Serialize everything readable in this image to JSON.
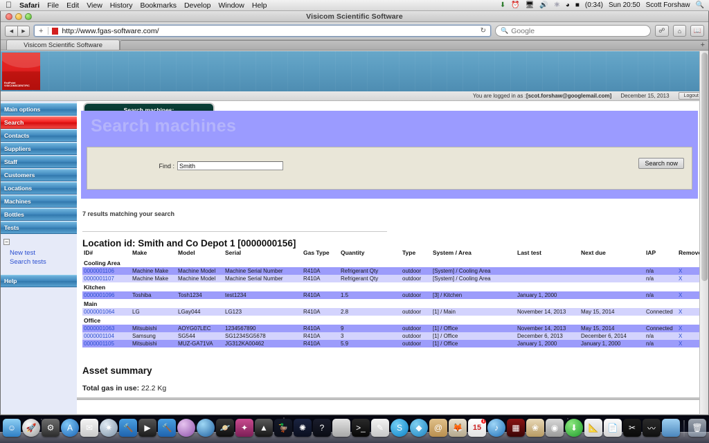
{
  "menubar": {
    "apple_glyph": "apple-logo",
    "items": [
      "Safari",
      "File",
      "Edit",
      "View",
      "History",
      "Bookmarks",
      "Develop",
      "Window",
      "Help"
    ],
    "status": {
      "battery_time": "(0:34)",
      "clock": "Sun 20:50",
      "user": "Scott Forshaw"
    }
  },
  "window": {
    "title": "Visicom Scientific Software",
    "url": "http://www.fgas-software.com/",
    "search_placeholder": "Google",
    "tab_label": "Visicom Scientific Software"
  },
  "loginbar": {
    "prefix": "You are logged in as :",
    "email": "[scot.forshaw@googlemail.com]",
    "date": "December 15, 2013",
    "logout": "Logout"
  },
  "logo": {
    "line1": "RedPoint",
    "line2": "VISICOMSCIENTIFIC"
  },
  "sidebar": {
    "items": [
      {
        "label": "Main options",
        "active": false
      },
      {
        "label": "Search",
        "active": true
      },
      {
        "label": "Contacts",
        "active": false
      },
      {
        "label": "Suppliers",
        "active": false
      },
      {
        "label": "Staff",
        "active": false
      },
      {
        "label": "Customers",
        "active": false
      },
      {
        "label": "Locations",
        "active": false
      },
      {
        "label": "Machines",
        "active": false
      },
      {
        "label": "Bottles",
        "active": false
      },
      {
        "label": "Tests",
        "active": false
      }
    ],
    "collapse_glyph": "−",
    "sublinks": [
      "New test",
      "Search tests"
    ],
    "help": "Help"
  },
  "panel": {
    "tab_label": "Search machines:",
    "heading": "Search machines",
    "find_label": "Find :",
    "find_value": "Smith",
    "search_button": "Search now"
  },
  "results": {
    "count_text": "7 results matching your search",
    "location_title": "Location id: Smith and Co Depot 1 [0000000156]"
  },
  "table": {
    "columns": [
      "ID#",
      "Make",
      "Model",
      "Serial",
      "Gas Type",
      "Quantity",
      "Type",
      "System / Area",
      "Last test",
      "Next due",
      "IAP",
      "Remove"
    ],
    "groups": [
      {
        "name": "Cooling Area",
        "rows": [
          {
            "id": "0000001106",
            "make": "Machine Make",
            "model": "Machine Model",
            "serial": "Machine Serial Number",
            "gas": "R410A",
            "qty": "Refrigerant Qty",
            "type": "outdoor",
            "system": "[System] / Cooling Area",
            "last": "",
            "next": "",
            "iap": "n/a",
            "remove": "X"
          },
          {
            "id": "0000001107",
            "make": "Machine Make",
            "model": "Machine Model",
            "serial": "Machine Serial Number",
            "gas": "R410A",
            "qty": "Refrigerant Qty",
            "type": "outdoor",
            "system": "[System] / Cooling Area",
            "last": "",
            "next": "",
            "iap": "n/a",
            "remove": "X"
          }
        ]
      },
      {
        "name": "Kitchen",
        "rows": [
          {
            "id": "0000001096",
            "make": "Toshiba",
            "model": "Tosh1234",
            "serial": "test1234",
            "gas": "R410A",
            "qty": "1.5",
            "type": "outdoor",
            "system": "[3] / Kitchen",
            "last": "January 1, 2000",
            "next": "",
            "iap": "n/a",
            "remove": "X"
          }
        ]
      },
      {
        "name": "Main",
        "rows": [
          {
            "id": "0000001064",
            "make": "LG",
            "model": "LGay044",
            "serial": "LG123",
            "gas": "R410A",
            "qty": "2.8",
            "type": "outdoor",
            "system": "[1] / Main",
            "last": "November 14, 2013",
            "next": "May 15, 2014",
            "iap": "Connected",
            "remove": "X"
          }
        ]
      },
      {
        "name": "Office",
        "rows": [
          {
            "id": "0000001063",
            "make": "Mitsubishi",
            "model": "AOYG07LEC",
            "serial": "1234567890",
            "gas": "R410A",
            "qty": "9",
            "type": "outdoor",
            "system": "[1] / Office",
            "last": "November 14, 2013",
            "next": "May 15, 2014",
            "iap": "Connected",
            "remove": "X"
          },
          {
            "id": "0000001104",
            "make": "Samsung",
            "model": "SG544",
            "serial": "SG1234SG5678",
            "gas": "R410A",
            "qty": "3",
            "type": "outdoor",
            "system": "[1] / Office",
            "last": "December 6, 2013",
            "next": "December 6, 2014",
            "iap": "n/a",
            "remove": "X"
          },
          {
            "id": "0000001105",
            "make": "Mitsubishi",
            "model": "MUZ-GA71VA",
            "serial": "JG312KA00462",
            "gas": "R410A",
            "qty": "5.9",
            "type": "outdoor",
            "system": "[1] / Office",
            "last": "January 1, 2000",
            "next": "January 1, 2000",
            "iap": "n/a",
            "remove": "X"
          }
        ]
      }
    ]
  },
  "asset_summary": {
    "heading": "Asset summary",
    "total_label": "Total gas in use:",
    "total_value": "22.2 Kg"
  },
  "dock": {
    "calendar_day": "15",
    "mail_badge": "1",
    "items": [
      {
        "name": "finder",
        "bg": "linear-gradient(#8fd0f5,#2f7fc4)",
        "glyph": "☺"
      },
      {
        "name": "launchpad",
        "bg": "radial-gradient(circle at 35% 30%,#fbfbfb,#9a9a9a)",
        "glyph": "🚀",
        "round": true
      },
      {
        "name": "system-preferences",
        "bg": "linear-gradient(#6d6d6d,#2c2c2c)",
        "glyph": "⚙"
      },
      {
        "name": "app-store",
        "bg": "radial-gradient(circle at 35% 30%,#7fc6f5,#1763b5)",
        "glyph": "A",
        "round": true
      },
      {
        "name": "mail",
        "bg": "linear-gradient(#f5f5f5,#c9c9c9)",
        "glyph": "✉"
      },
      {
        "name": "safari",
        "bg": "radial-gradient(circle at 35% 30%,#dfe9f2,#7d93a8)",
        "glyph": "✷",
        "round": true
      },
      {
        "name": "xcode",
        "bg": "linear-gradient(#4a9fe0,#1f63ad)",
        "glyph": "🔨"
      },
      {
        "name": "quicktime",
        "bg": "linear-gradient(#555,#1b1b1b)",
        "glyph": "▶"
      },
      {
        "name": "xcode-beta",
        "bg": "linear-gradient(#4a9fe0,#1f63ad)",
        "glyph": "🔨"
      },
      {
        "name": "sphere-app",
        "bg": "radial-gradient(circle at 35% 30%,#e7c4f0,#8b4fa8)",
        "glyph": "",
        "round": true
      },
      {
        "name": "firefox",
        "bg": "radial-gradient(circle at 35% 30%,#9fd8f5,#1d5fa0)",
        "glyph": "",
        "round": true
      },
      {
        "name": "saturn-app",
        "bg": "linear-gradient(#3a3a3a,#0e0e0e)",
        "glyph": "🪐"
      },
      {
        "name": "comet-app",
        "bg": "linear-gradient(#c94b8f,#7d1f56)",
        "glyph": "✦"
      },
      {
        "name": "blender",
        "bg": "linear-gradient(#5a5a5a,#151515)",
        "glyph": "▲"
      },
      {
        "name": "rubber-duck",
        "bg": "linear-gradient(#151a2a,#0b0e18)",
        "glyph": "🦆"
      },
      {
        "name": "wolfram",
        "bg": "linear-gradient(#1a2340,#0a0f1f)",
        "glyph": "✺"
      },
      {
        "name": "unknown-app",
        "bg": "linear-gradient(#1a1d2c,#0a0c14)",
        "glyph": "?"
      },
      {
        "name": "calculator",
        "bg": "linear-gradient(#e3e3e3,#a8a8a8)",
        "glyph": ""
      },
      {
        "name": "terminal",
        "bg": "linear-gradient(#2a2a2a,#070707)",
        "glyph": ">_"
      },
      {
        "name": "text-editor",
        "bg": "linear-gradient(#f3f3f3,#c7c7c7)",
        "glyph": "✎"
      },
      {
        "name": "skype",
        "bg": "radial-gradient(circle at 35% 30%,#72cdf4,#0a82c7)",
        "glyph": "S",
        "round": true
      },
      {
        "name": "dropbox",
        "bg": "radial-gradient(circle at 35% 30%,#7fcff0,#1a82c0)",
        "glyph": "◆",
        "round": true
      },
      {
        "name": "address-book",
        "bg": "linear-gradient(#e0c08a,#b98f4f)",
        "glyph": "@"
      },
      {
        "name": "gimp",
        "bg": "linear-gradient(#e8e0cf,#b5a98d)",
        "glyph": "🦊"
      },
      {
        "name": "calendar",
        "bg": "linear-gradient(#fff,#e2e2e2)",
        "glyph": ""
      },
      {
        "name": "itunes",
        "bg": "radial-gradient(circle at 35% 30%,#9fd6f7,#1d6fb8)",
        "glyph": "♪",
        "round": true
      },
      {
        "name": "photos-red",
        "bg": "linear-gradient(#8a1414,#3b0606)",
        "glyph": "▦"
      },
      {
        "name": "iphoto",
        "bg": "linear-gradient(#e9d9b8,#b79a63)",
        "glyph": "❀"
      },
      {
        "name": "disk-utility",
        "bg": "linear-gradient(#d8d8d8,#9a9a9a)",
        "glyph": "◉"
      },
      {
        "name": "installer",
        "bg": "radial-gradient(circle at 35% 30%,#8ce87f,#1d9b2a)",
        "glyph": "⬇",
        "round": true
      },
      {
        "name": "sketch-tools",
        "bg": "linear-gradient(#f4f4f4,#cfcfcf)",
        "glyph": "📐"
      },
      {
        "name": "documents",
        "bg": "linear-gradient(#fbfbfb,#d4d4d4)",
        "glyph": "📄"
      },
      {
        "name": "inkscape",
        "bg": "linear-gradient(#1d1d1d,#0a0a0a)",
        "glyph": "✂"
      },
      {
        "name": "activity-monitor",
        "bg": "linear-gradient(#2b2b2b,#101010)",
        "glyph": "〰"
      },
      {
        "name": "downloads-stack",
        "bg": "linear-gradient(#9fd0f2,#4a86bd)",
        "glyph": ""
      },
      {
        "name": "trash",
        "bg": "linear-gradient(rgba(220,230,240,.7),rgba(160,180,200,.5))",
        "glyph": "🗑"
      }
    ]
  }
}
